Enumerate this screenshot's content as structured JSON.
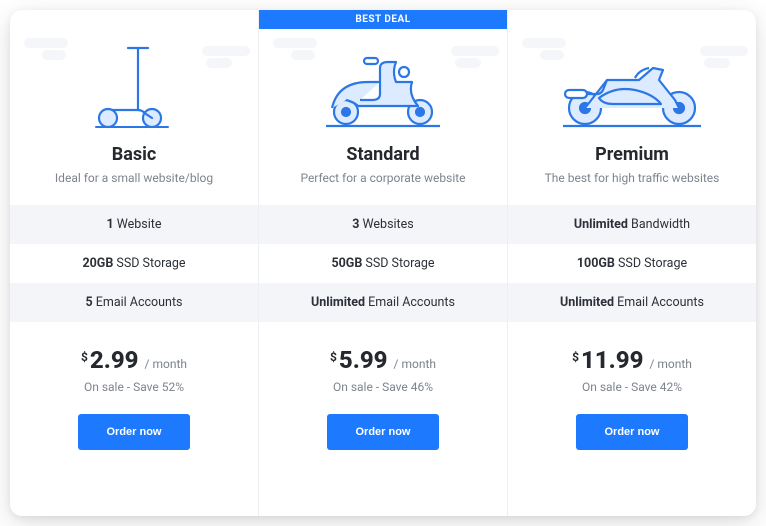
{
  "badge": "BEST DEAL",
  "plans": [
    {
      "name": "Basic",
      "tagline": "Ideal for a small website/blog",
      "features": [
        {
          "bold": "1",
          "rest": " Website"
        },
        {
          "bold": "20GB",
          "rest": " SSD Storage"
        },
        {
          "bold": "5",
          "rest": " Email Accounts"
        }
      ],
      "currency": "$",
      "price": "2.99",
      "period": "/ month",
      "save": "On sale - Save 52%",
      "button": "Order now"
    },
    {
      "name": "Standard",
      "tagline": "Perfect for a corporate website",
      "features": [
        {
          "bold": "3",
          "rest": " Websites"
        },
        {
          "bold": "50GB",
          "rest": " SSD Storage"
        },
        {
          "bold": "Unlimited",
          "rest": " Email Accounts"
        }
      ],
      "currency": "$",
      "price": "5.99",
      "period": "/ month",
      "save": "On sale - Save 46%",
      "button": "Order now"
    },
    {
      "name": "Premium",
      "tagline": "The best for high traffic websites",
      "features": [
        {
          "bold": "Unlimited",
          "rest": " Bandwidth"
        },
        {
          "bold": "100GB",
          "rest": " SSD Storage"
        },
        {
          "bold": "Unlimited",
          "rest": " Email Accounts"
        }
      ],
      "currency": "$",
      "price": "11.99",
      "period": "/ month",
      "save": "On sale - Save 42%",
      "button": "Order now"
    }
  ]
}
